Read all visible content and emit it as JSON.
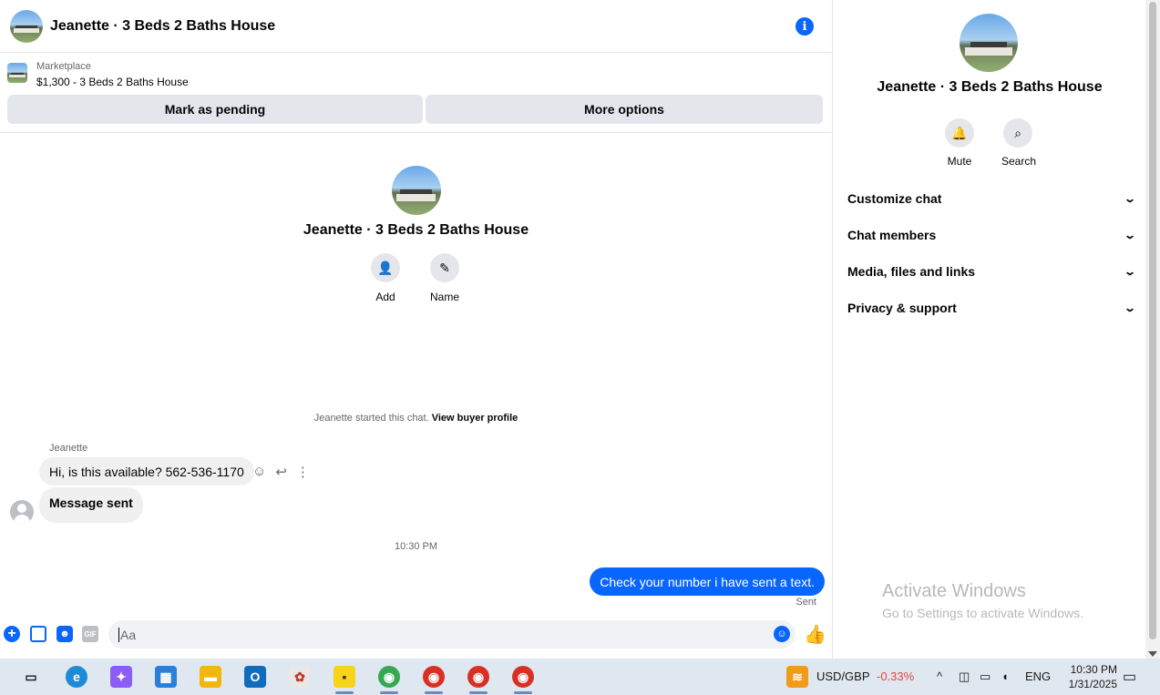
{
  "header": {
    "title": "Jeanette · 3 Beds 2 Baths House"
  },
  "listing": {
    "source": "Marketplace",
    "title": "$1,300 - 3 Beds 2 Baths House",
    "pending_label": "Mark as pending",
    "more_label": "More options"
  },
  "intro": {
    "name": "Jeanette · 3 Beds 2 Baths House",
    "add_label": "Add",
    "name_label": "Name"
  },
  "conversation": {
    "started_text": "Jeanette started this chat.",
    "buyer_profile_link": "View buyer profile",
    "sender": "Jeanette",
    "msg1": "Hi, is this available? 562-536-1170",
    "msg2": "Message sent",
    "timestamp": "10:30 PM",
    "outgoing": "Check your number i have sent a text.",
    "status": "Sent"
  },
  "composer": {
    "placeholder": "Aa",
    "gif_label": "GIF"
  },
  "side": {
    "title": "Jeanette · 3 Beds 2 Baths House",
    "mute_label": "Mute",
    "search_label": "Search",
    "menu": [
      {
        "label": "Customize chat"
      },
      {
        "label": "Chat members"
      },
      {
        "label": "Media, files and links"
      },
      {
        "label": "Privacy & support"
      }
    ]
  },
  "watermark": {
    "title": "Activate Windows",
    "subtitle": "Go to Settings to activate Windows."
  },
  "taskbar": {
    "currency_pair": "USD/GBP",
    "currency_change": "-0.33%",
    "language": "ENG",
    "time": "10:30 PM",
    "date": "1/31/2025"
  },
  "colors": {
    "accent": "#0866ff",
    "negative": "#e0463b"
  }
}
